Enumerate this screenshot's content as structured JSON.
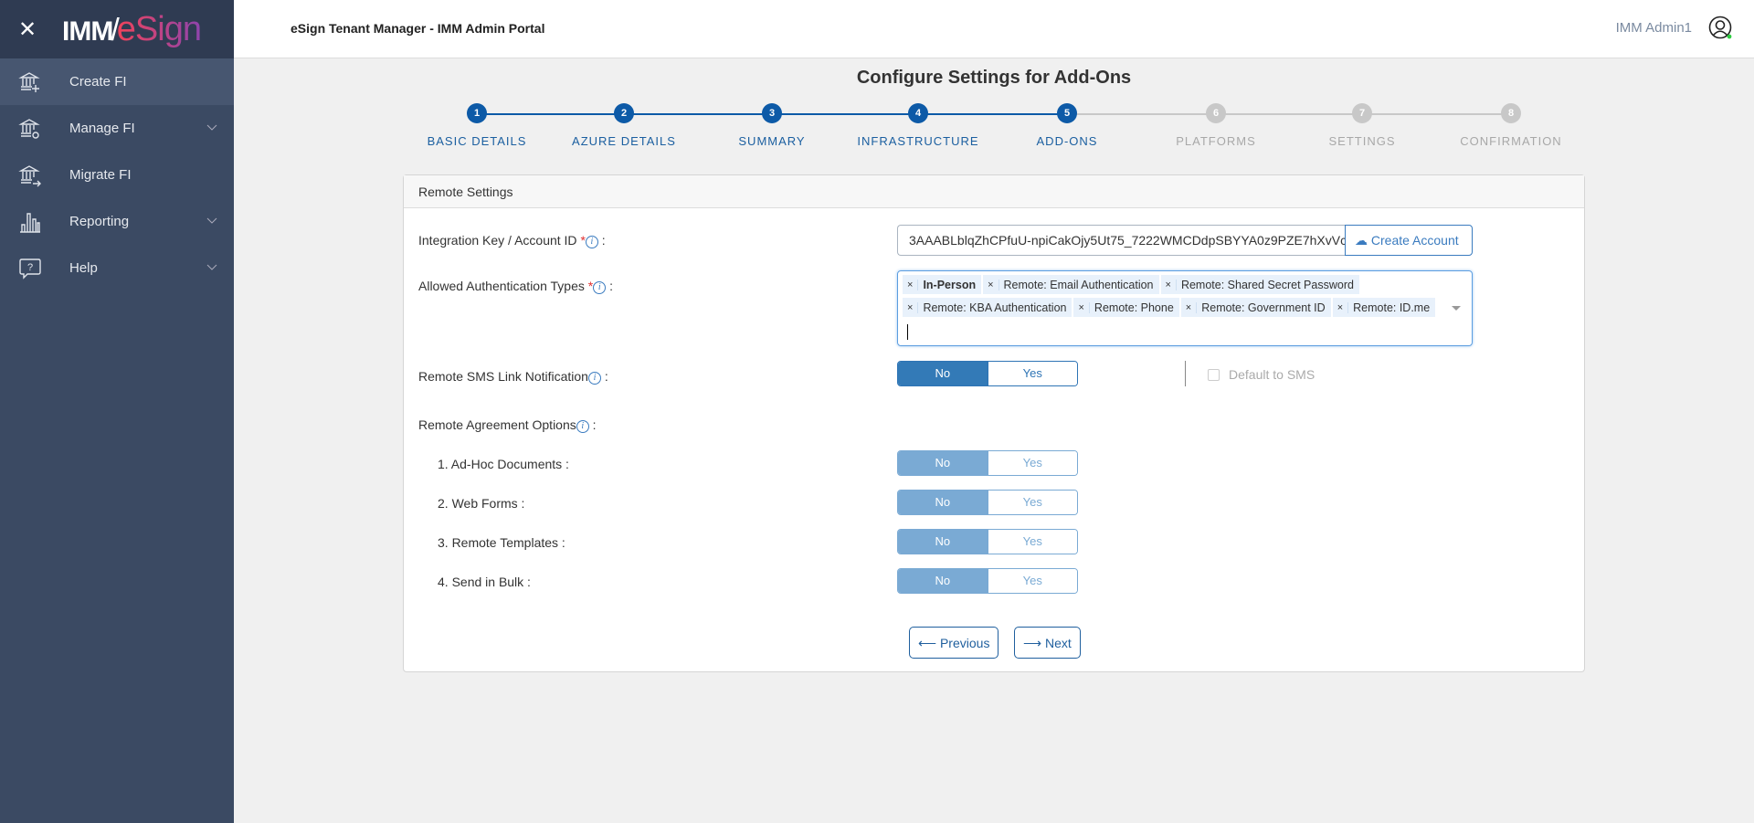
{
  "sidebar": {
    "close_icon": "close-icon",
    "logo": "IMM/eSign",
    "items": [
      {
        "label": "Create FI",
        "icon": "bank-plus-icon",
        "active": true
      },
      {
        "label": "Manage FI",
        "icon": "bank-gear-icon",
        "expandable": true
      },
      {
        "label": "Migrate FI",
        "icon": "bank-arrow-icon"
      },
      {
        "label": "Reporting",
        "icon": "bar-chart-icon",
        "expandable": true
      },
      {
        "label": "Help",
        "icon": "help-bubble-icon",
        "expandable": true
      }
    ]
  },
  "header": {
    "title": "eSign Tenant Manager - IMM Admin Portal",
    "user": "IMM Admin1",
    "status_color": "#2ecc40"
  },
  "page": {
    "title": "Configure Settings for Add-Ons"
  },
  "stepper": {
    "active_color": "#0d5aa7",
    "inactive_color": "#c8c8c8",
    "steps": [
      {
        "num": "1",
        "label": "BASIC DETAILS",
        "done": true
      },
      {
        "num": "2",
        "label": "AZURE DETAILS",
        "done": true
      },
      {
        "num": "3",
        "label": "SUMMARY",
        "done": true
      },
      {
        "num": "4",
        "label": "INFRASTRUCTURE",
        "done": true
      },
      {
        "num": "5",
        "label": "ADD-ONS",
        "done": true
      },
      {
        "num": "6",
        "label": "PLATFORMS",
        "done": false
      },
      {
        "num": "7",
        "label": "SETTINGS",
        "done": false
      },
      {
        "num": "8",
        "label": "CONFIRMATION",
        "done": false
      }
    ]
  },
  "panel": {
    "title": "Remote Settings",
    "integration": {
      "label": "Integration Key / Account ID",
      "value": "3AAABLblqZhCPfuU-npiCakOjy5Ut75_7222WMCDdpSBYYA0z9PZE7hXvVc",
      "button": "Create Account"
    },
    "auth": {
      "label": "Allowed Authentication Types",
      "tags": [
        "In-Person",
        "Remote: Email Authentication",
        "Remote: Shared Secret Password",
        "Remote: KBA Authentication",
        "Remote: Phone",
        "Remote: Government ID",
        "Remote: ID.me"
      ]
    },
    "sms": {
      "label": "Remote SMS Link Notification",
      "no": "No",
      "yes": "Yes",
      "selected": "No",
      "default_label": "Default to SMS",
      "default_checked": false
    },
    "agreement": {
      "label": "Remote Agreement Options",
      "options": [
        {
          "label": "1. Ad-Hoc Documents :",
          "no": "No",
          "yes": "Yes",
          "selected": "No"
        },
        {
          "label": "2. Web Forms :",
          "no": "No",
          "yes": "Yes",
          "selected": "No"
        },
        {
          "label": "3. Remote Templates :",
          "no": "No",
          "yes": "Yes",
          "selected": "No"
        },
        {
          "label": "4. Send in Bulk :",
          "no": "No",
          "yes": "Yes",
          "selected": "No"
        }
      ]
    },
    "previous": "Previous",
    "next": "Next"
  }
}
